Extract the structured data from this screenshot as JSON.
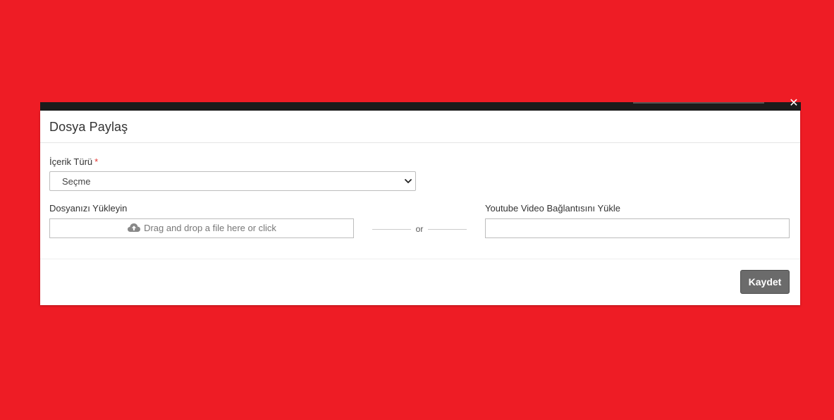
{
  "modal": {
    "title": "Dosya Paylaş",
    "close_glyph": "✕"
  },
  "form": {
    "content_type": {
      "label": "İçerik Türü",
      "required_mark": "*",
      "selected_value": "Seçme"
    },
    "upload": {
      "label": "Dosyanızı Yükleyin",
      "dropzone_text": "Drag and drop a file here or click"
    },
    "divider_text": "or",
    "youtube": {
      "label": "Youtube Video Bağlantısını Yükle",
      "value": ""
    }
  },
  "footer": {
    "save_label": "Kaydet"
  },
  "colors": {
    "page_background": "#ee1c25",
    "button_background": "#6b6b6b",
    "required": "#e3342f"
  },
  "icons": {
    "upload": "cloud-upload-icon",
    "select": "chevron-down-icon",
    "close": "close-icon"
  }
}
